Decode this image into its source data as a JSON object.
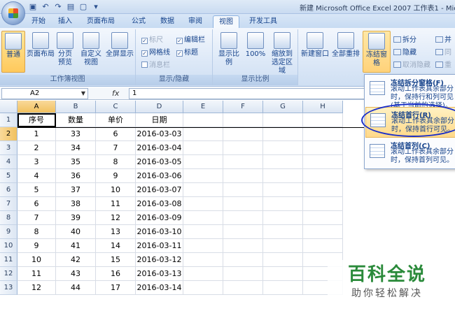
{
  "window_title": "新建 Microsoft Office Excel 2007 工作表1 - Micr",
  "tabs": [
    "开始",
    "插入",
    "页面布局",
    "公式",
    "数据",
    "审阅",
    "视图",
    "开发工具"
  ],
  "active_tab": "视图",
  "ribbon": {
    "workbook_views": {
      "label": "工作簿视图",
      "normal": "普通",
      "page_layout": "页面布局",
      "page_break": "分页预览",
      "custom": "自定义视图",
      "fullscreen": "全屏显示"
    },
    "show_hide": {
      "label": "显示/隐藏",
      "ruler": "标尺",
      "gridlines": "网格线",
      "message_bar": "消息栏",
      "formula_bar": "编辑栏",
      "headings": "标题"
    },
    "zoom": {
      "label": "显示比例",
      "zoom": "显示比例",
      "zoom100": "100%",
      "zoom_selection": "缩放到选定区域"
    },
    "window": {
      "new_window": "新建窗口",
      "arrange_all": "全部重排",
      "freeze_panes": "冻结窗格",
      "split": "拆分",
      "hide": "隐藏",
      "unhide": "取消隐藏",
      "side_by_side": "并",
      "sync": "同",
      "reset": "重"
    }
  },
  "formula_bar": {
    "name_box": "A2",
    "fx": "fx",
    "value": "1"
  },
  "columns": [
    "A",
    "B",
    "C",
    "D",
    "E",
    "F",
    "G",
    "H"
  ],
  "rows": [
    "1",
    "2",
    "3",
    "4",
    "5",
    "6",
    "7",
    "8",
    "9",
    "10",
    "11",
    "12",
    "13"
  ],
  "table": {
    "headers": [
      "序号",
      "数量",
      "单价",
      "日期"
    ],
    "data": [
      [
        "1",
        "33",
        "6",
        "2016-03-03"
      ],
      [
        "2",
        "34",
        "7",
        "2016-03-04"
      ],
      [
        "3",
        "35",
        "8",
        "2016-03-05"
      ],
      [
        "4",
        "36",
        "9",
        "2016-03-06"
      ],
      [
        "5",
        "37",
        "10",
        "2016-03-07"
      ],
      [
        "6",
        "38",
        "11",
        "2016-03-08"
      ],
      [
        "7",
        "39",
        "12",
        "2016-03-09"
      ],
      [
        "8",
        "40",
        "13",
        "2016-03-10"
      ],
      [
        "9",
        "41",
        "14",
        "2016-03-11"
      ],
      [
        "10",
        "42",
        "15",
        "2016-03-12"
      ],
      [
        "11",
        "43",
        "16",
        "2016-03-13"
      ],
      [
        "12",
        "44",
        "17",
        "2016-03-14"
      ]
    ]
  },
  "freeze_menu": [
    {
      "title": "冻结拆分窗格(F)",
      "desc": "滚动工作表其余部分时，保持行和列可见(基于当前的选择)。"
    },
    {
      "title": "冻结首行(R)",
      "desc": "滚动工作表其余部分时，保持首行可见。"
    },
    {
      "title": "冻结首列(C)",
      "desc": "滚动工作表其余部分时，保持首列可见。"
    }
  ],
  "watermark": {
    "line1": "百科全说",
    "line2": "助你轻松解决"
  }
}
